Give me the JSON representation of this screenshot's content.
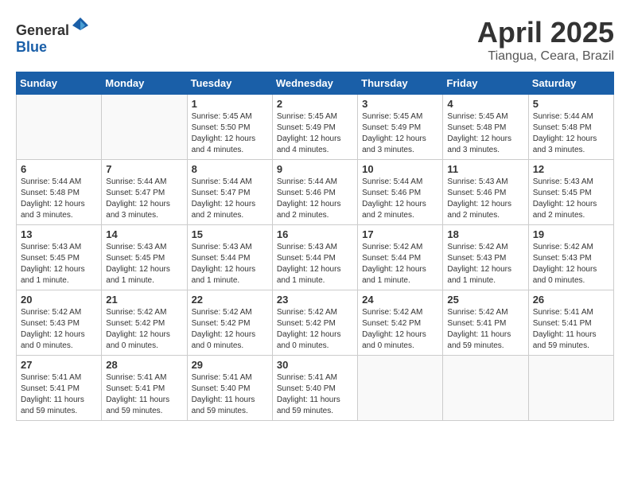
{
  "header": {
    "logo_general": "General",
    "logo_blue": "Blue",
    "month_year": "April 2025",
    "location": "Tiangua, Ceara, Brazil"
  },
  "weekdays": [
    "Sunday",
    "Monday",
    "Tuesday",
    "Wednesday",
    "Thursday",
    "Friday",
    "Saturday"
  ],
  "weeks": [
    [
      {
        "day": "",
        "info": ""
      },
      {
        "day": "",
        "info": ""
      },
      {
        "day": "1",
        "info": "Sunrise: 5:45 AM\nSunset: 5:50 PM\nDaylight: 12 hours\nand 4 minutes."
      },
      {
        "day": "2",
        "info": "Sunrise: 5:45 AM\nSunset: 5:49 PM\nDaylight: 12 hours\nand 4 minutes."
      },
      {
        "day": "3",
        "info": "Sunrise: 5:45 AM\nSunset: 5:49 PM\nDaylight: 12 hours\nand 3 minutes."
      },
      {
        "day": "4",
        "info": "Sunrise: 5:45 AM\nSunset: 5:48 PM\nDaylight: 12 hours\nand 3 minutes."
      },
      {
        "day": "5",
        "info": "Sunrise: 5:44 AM\nSunset: 5:48 PM\nDaylight: 12 hours\nand 3 minutes."
      }
    ],
    [
      {
        "day": "6",
        "info": "Sunrise: 5:44 AM\nSunset: 5:48 PM\nDaylight: 12 hours\nand 3 minutes."
      },
      {
        "day": "7",
        "info": "Sunrise: 5:44 AM\nSunset: 5:47 PM\nDaylight: 12 hours\nand 3 minutes."
      },
      {
        "day": "8",
        "info": "Sunrise: 5:44 AM\nSunset: 5:47 PM\nDaylight: 12 hours\nand 2 minutes."
      },
      {
        "day": "9",
        "info": "Sunrise: 5:44 AM\nSunset: 5:46 PM\nDaylight: 12 hours\nand 2 minutes."
      },
      {
        "day": "10",
        "info": "Sunrise: 5:44 AM\nSunset: 5:46 PM\nDaylight: 12 hours\nand 2 minutes."
      },
      {
        "day": "11",
        "info": "Sunrise: 5:43 AM\nSunset: 5:46 PM\nDaylight: 12 hours\nand 2 minutes."
      },
      {
        "day": "12",
        "info": "Sunrise: 5:43 AM\nSunset: 5:45 PM\nDaylight: 12 hours\nand 2 minutes."
      }
    ],
    [
      {
        "day": "13",
        "info": "Sunrise: 5:43 AM\nSunset: 5:45 PM\nDaylight: 12 hours\nand 1 minute."
      },
      {
        "day": "14",
        "info": "Sunrise: 5:43 AM\nSunset: 5:45 PM\nDaylight: 12 hours\nand 1 minute."
      },
      {
        "day": "15",
        "info": "Sunrise: 5:43 AM\nSunset: 5:44 PM\nDaylight: 12 hours\nand 1 minute."
      },
      {
        "day": "16",
        "info": "Sunrise: 5:43 AM\nSunset: 5:44 PM\nDaylight: 12 hours\nand 1 minute."
      },
      {
        "day": "17",
        "info": "Sunrise: 5:42 AM\nSunset: 5:44 PM\nDaylight: 12 hours\nand 1 minute."
      },
      {
        "day": "18",
        "info": "Sunrise: 5:42 AM\nSunset: 5:43 PM\nDaylight: 12 hours\nand 1 minute."
      },
      {
        "day": "19",
        "info": "Sunrise: 5:42 AM\nSunset: 5:43 PM\nDaylight: 12 hours\nand 0 minutes."
      }
    ],
    [
      {
        "day": "20",
        "info": "Sunrise: 5:42 AM\nSunset: 5:43 PM\nDaylight: 12 hours\nand 0 minutes."
      },
      {
        "day": "21",
        "info": "Sunrise: 5:42 AM\nSunset: 5:42 PM\nDaylight: 12 hours\nand 0 minutes."
      },
      {
        "day": "22",
        "info": "Sunrise: 5:42 AM\nSunset: 5:42 PM\nDaylight: 12 hours\nand 0 minutes."
      },
      {
        "day": "23",
        "info": "Sunrise: 5:42 AM\nSunset: 5:42 PM\nDaylight: 12 hours\nand 0 minutes."
      },
      {
        "day": "24",
        "info": "Sunrise: 5:42 AM\nSunset: 5:42 PM\nDaylight: 12 hours\nand 0 minutes."
      },
      {
        "day": "25",
        "info": "Sunrise: 5:42 AM\nSunset: 5:41 PM\nDaylight: 11 hours\nand 59 minutes."
      },
      {
        "day": "26",
        "info": "Sunrise: 5:41 AM\nSunset: 5:41 PM\nDaylight: 11 hours\nand 59 minutes."
      }
    ],
    [
      {
        "day": "27",
        "info": "Sunrise: 5:41 AM\nSunset: 5:41 PM\nDaylight: 11 hours\nand 59 minutes."
      },
      {
        "day": "28",
        "info": "Sunrise: 5:41 AM\nSunset: 5:41 PM\nDaylight: 11 hours\nand 59 minutes."
      },
      {
        "day": "29",
        "info": "Sunrise: 5:41 AM\nSunset: 5:40 PM\nDaylight: 11 hours\nand 59 minutes."
      },
      {
        "day": "30",
        "info": "Sunrise: 5:41 AM\nSunset: 5:40 PM\nDaylight: 11 hours\nand 59 minutes."
      },
      {
        "day": "",
        "info": ""
      },
      {
        "day": "",
        "info": ""
      },
      {
        "day": "",
        "info": ""
      }
    ]
  ]
}
